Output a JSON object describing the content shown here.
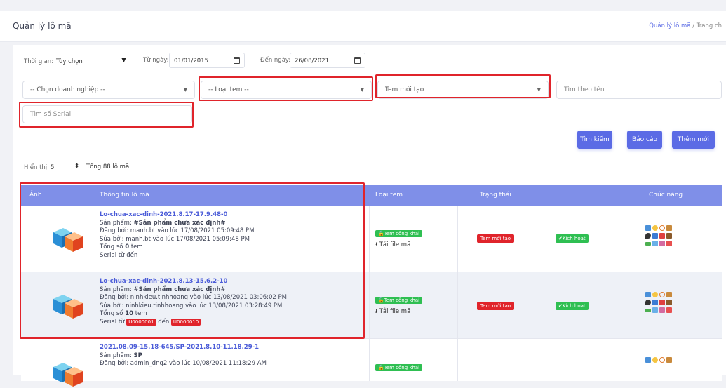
{
  "page_title": "Quản lý lô mã",
  "breadcrumb": {
    "current": "Quản lý lô mã",
    "sep": "/",
    "home": "Trang ch"
  },
  "filters": {
    "time_label": "Thời gian:",
    "time_value": "Tùy chọn",
    "from_label": "Từ ngày:",
    "from_value": "01/01/2015",
    "to_label": "Đến ngày:",
    "to_value": "26/08/2021",
    "company": "-- Chọn doanh nghiệp --",
    "stamp_type": "-- Loại tem --",
    "status": "Tem mới tạo",
    "name_placeholder": "Tìm theo tên",
    "serial_placeholder": "Tìm số Serial"
  },
  "buttons": {
    "search": "Tìm kiếm",
    "report": "Báo cáo",
    "add": "Thêm mới"
  },
  "paging": {
    "show_label": "Hiển thị",
    "page_size": "5",
    "total": "Tổng 88 lô mã"
  },
  "columns": {
    "image": "Ảnh",
    "info": "Thông tin lô mã",
    "type": "Loại tem",
    "status": "Trạng thái",
    "functions": "Chức năng"
  },
  "rows": [
    {
      "code": "Lo-chua-xac-dinh-2021.8.17-17.9.48-0",
      "product_label": "Sản phẩm:",
      "product": "#Sản phẩm chưa xác định#",
      "created": "Đăng bởi: manh.bt vào lúc 17/08/2021 05:09:48 PM",
      "edited": "Sửa bởi: manh.bt vào lúc 17/08/2021 05:09:48 PM",
      "total_label": "Tổng số",
      "total": "0",
      "total_unit": "tem",
      "serial_from": "Serial từ",
      "serial_to": "đến",
      "type": "Tem công khai",
      "download": "Tải file mã",
      "status": "Tem mới tạo",
      "active": "Kích hoạt"
    },
    {
      "code": "Lo-chua-xac-dinh-2021.8.13-15.6.2-10",
      "product_label": "Sản phẩm:",
      "product": "#Sản phẩm chưa xác định#",
      "created": "Đăng bởi: ninhkieu.tinhhoang vào lúc 13/08/2021 03:06:02 PM",
      "edited": "Sửa bởi: ninhkieu.tinhhoang vào lúc 13/08/2021 03:28:49 PM",
      "total_label": "Tổng số",
      "total": "10",
      "total_unit": "tem",
      "serial_from": "Serial từ",
      "serial_start": "U0000001",
      "serial_to": "đến",
      "serial_end": "U0000010",
      "type": "Tem công khai",
      "download": "Tải file mã",
      "status": "Tem mới tạo",
      "active": "Kích hoạt"
    },
    {
      "code": "2021.08.09-15.18-645/SP-2021.8.10-11.18.29-1",
      "product_label": "Sản phẩm:",
      "product": "SP",
      "created": "Đăng bởi: admin_dng2 vào lúc 10/08/2021 11:18:29 AM",
      "type": "Tem công khai"
    }
  ],
  "colors": {
    "accent": "#5b6be5",
    "header": "#7f8fe8",
    "highlight": "#e0242b",
    "success": "#2fbf52"
  }
}
